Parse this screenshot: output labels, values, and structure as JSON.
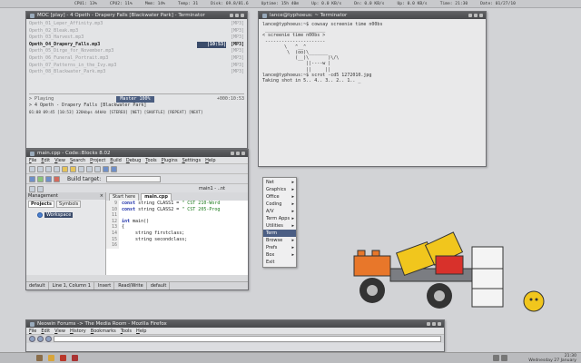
{
  "topbar": {
    "items": [
      "CPU1: 13%",
      "CPU2: 11%",
      "Mem: 14%",
      "Temp: 31",
      "Disk: 69.8/81.6",
      "Uptime: 15h 40m",
      "Up: 0.0 KB/s",
      "Dn: 0.0 KB/s",
      "Up: 0.0 KB/s",
      "Time: 21:30",
      "Date: 01/27/10"
    ]
  },
  "moc": {
    "title": "MOC [play] - 4 Opeth - Drapery Falls [Blackwater Park] - Terminator",
    "tracks": [
      {
        "name": "Opeth_01_Leper_Affinity.mp3",
        "time": "",
        "fmt": "[MP3]"
      },
      {
        "name": "Opeth_02_Bleak.mp3",
        "time": "",
        "fmt": "[MP3]"
      },
      {
        "name": "Opeth_03_Harvest.mp3",
        "time": "",
        "fmt": "[MP3]"
      },
      {
        "name": "Opeth_04_Drapery_Falls.mp3",
        "time": "|10:53|",
        "fmt": "[MP3]",
        "selected": true
      },
      {
        "name": "Opeth_05_Dirge_for_November.mp3",
        "time": "",
        "fmt": "[MP3]"
      },
      {
        "name": "Opeth_06_Funeral_Portrait.mp3",
        "time": "",
        "fmt": "[MP3]"
      },
      {
        "name": "Opeth_07_Patterns_in_the_Ivy.mp3",
        "time": "",
        "fmt": "[MP3]"
      },
      {
        "name": "Opeth_08_Blackwater_Park.mp3",
        "time": "",
        "fmt": "[MP3]"
      }
    ],
    "master": "Master 100%",
    "playing_state": "> Playing",
    "counter": "+000:10:53",
    "now_playing": "> 4 Opeth - Drapery Falls [Blackwater Park]",
    "status": "01:08 09:45 [10:53]  320kbps  44kHz  [STEREO] [NET] [SHUFFLE] [REPEAT] [NEXT]"
  },
  "terminal": {
    "title": "lance@typhoeus: ~ Terminator",
    "lines": [
      "lance@typhoeus:~$ cowsay screenie time n00bs",
      " ______________________",
      "< screenie time n00bs >",
      " ----------------------",
      "        \\   ^__^",
      "         \\  (oo)\\_______",
      "            (__)\\       )\\/\\",
      "                ||----w |",
      "                ||     ||",
      "lance@typhoeus:~$ scrot -cd5 1272010.jpg",
      "Taking shot in 5.. 4.. 3.. 2.. 1.. _"
    ]
  },
  "codeblocks": {
    "title": "main.cpp - Code::Blocks 8.02",
    "menu": [
      "File",
      "Edit",
      "View",
      "Search",
      "Project",
      "Build",
      "Debug",
      "Tools",
      "Plugins",
      "Settings",
      "Help"
    ],
    "build_target": "Build target:",
    "file_tab": "main1 - ..nt",
    "management": "Management",
    "mgmt_tabs": [
      "Projects",
      "Symbols"
    ],
    "workspace": "Workspace",
    "editor_tabs": [
      "Start here",
      "main.cpp"
    ],
    "line_numbers": [
      "9",
      "10",
      "11",
      "12",
      "13",
      "14",
      "15",
      "16"
    ],
    "code": [
      [
        "const string CLASS1 = ",
        "\" CST 210-Word"
      ],
      [
        "const string CLASS2 = ",
        "\" CST 205-Prog"
      ],
      [
        "",
        ""
      ],
      [
        "int main()",
        ""
      ],
      [
        "{",
        ""
      ],
      [
        "     string firstclass;",
        ""
      ],
      [
        "     string secondclass;",
        ""
      ],
      [
        "",
        ""
      ]
    ],
    "status": [
      "default",
      "Line 1, Column 1",
      "Insert",
      "Read/Write",
      "default"
    ]
  },
  "menu": {
    "items": [
      "Net",
      "Graphics",
      "Office",
      "Coding",
      "A/V",
      "Term Apps",
      "Utilities",
      "Term",
      "Browse",
      "Prefs",
      "Box",
      "Exit"
    ],
    "arrows": [
      "▸",
      "▸",
      "▸",
      "▸",
      "▸",
      "▸",
      "▸",
      "",
      "▸",
      "▸",
      "▸",
      ""
    ],
    "highlight": "Term"
  },
  "firefox": {
    "title": "Neowin Forums -> The Media Room - Mozilla Firefox",
    "menu": [
      "File",
      "Edit",
      "View",
      "History",
      "Bookmarks",
      "Tools",
      "Help"
    ]
  },
  "clock": {
    "time": "21:30",
    "date": "Wednesday 27 January"
  }
}
